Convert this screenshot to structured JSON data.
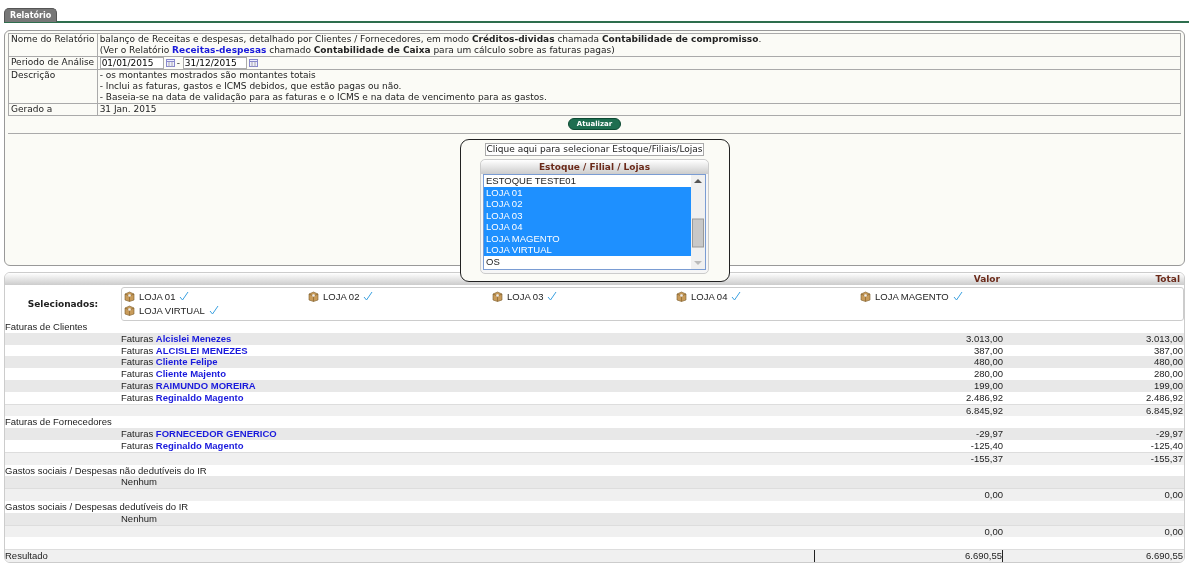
{
  "tabs": [
    {
      "label": "Relatório",
      "selected": true
    }
  ],
  "report_info": {
    "name": {
      "label": "Nome do Relatório",
      "line_1": "balanço de Receitas e despesas, detalhado por Clientes / Fornecedores, em modo **Créditos-dividas** chamada **Contabilidade de compromisso**.",
      "line_2_before": "(Ver o Relatório",
      "line_2_link": "Receitas-despesas",
      "line_2_after": "chamado **Contabilidade de Caixa** para um cálculo sobre as faturas pagas)"
    },
    "period": {
      "label": "Periodo de Análise",
      "from": "01/01/2015",
      "separator": "-",
      "to": "31/12/2015"
    },
    "description": {
      "label": "Descrição",
      "lines": [
        "- os montantes mostrados são montantes totais",
        "- Inclui as faturas, gastos e ICMS debidos, que estão pagas ou não.",
        "- Baseia-se na data de validação para as faturas e o ICMS e na data de vencimento para as gastos."
      ]
    },
    "generated": {
      "label": "Gerado a",
      "value": "31 Jan. 2015"
    }
  },
  "update_button": "Atualizar",
  "store_selector": {
    "toggle_label": "Clique aqui para selecionar Estoque/Filiais/Lojas",
    "title": "Estoque / Filial / Lojas",
    "options": [
      {
        "label": "ESTOQUE TESTE01",
        "selected": false
      },
      {
        "label": "LOJA 01",
        "selected": true
      },
      {
        "label": "LOJA 02",
        "selected": true
      },
      {
        "label": "LOJA 03",
        "selected": true
      },
      {
        "label": "LOJA 04",
        "selected": true
      },
      {
        "label": "LOJA MAGENTO",
        "selected": true
      },
      {
        "label": "LOJA VIRTUAL",
        "selected": true
      },
      {
        "label": "OS",
        "selected": false
      }
    ]
  },
  "results": {
    "columns": [
      "Valor",
      "Total"
    ],
    "selected_label": "Selecionados:",
    "selected_stores": [
      {
        "label": "LOJA 01",
        "checked": true
      },
      {
        "label": "LOJA 02",
        "checked": true
      },
      {
        "label": "LOJA 03",
        "checked": true
      },
      {
        "label": "LOJA 04",
        "checked": true
      },
      {
        "label": "LOJA MAGENTO",
        "checked": true
      },
      {
        "label": "LOJA VIRTUAL",
        "checked": true
      }
    ],
    "sections": [
      {
        "title": "Faturas de Clientes",
        "rows": [
          {
            "prefix": "Faturas",
            "name": "Alcislei Menezes",
            "valor": "3.013,00",
            "total": "3.013,00"
          },
          {
            "prefix": "Faturas",
            "name": "ALCISLEI MENEZES",
            "valor": "387,00",
            "total": "387,00"
          },
          {
            "prefix": "Faturas",
            "name": "Cliente Felipe",
            "valor": "480,00",
            "total": "480,00"
          },
          {
            "prefix": "Faturas",
            "name": "Cliente Majento",
            "valor": "280,00",
            "total": "280,00"
          },
          {
            "prefix": "Faturas",
            "name": "RAIMUNDO MOREIRA",
            "valor": "199,00",
            "total": "199,00"
          },
          {
            "prefix": "Faturas",
            "name": "Reginaldo Magento",
            "valor": "2.486,92",
            "total": "2.486,92"
          }
        ],
        "subtotal": {
          "valor": "6.845,92",
          "total": "6.845,92"
        }
      },
      {
        "title": "Faturas de Fornecedores",
        "rows": [
          {
            "prefix": "Faturas",
            "name": "FORNECEDOR GENERICO",
            "valor": "-29,97",
            "total": "-29,97"
          },
          {
            "prefix": "Faturas",
            "name": "Reginaldo Magento",
            "valor": "-125,40",
            "total": "-125,40"
          }
        ],
        "subtotal": {
          "valor": "-155,37",
          "total": "-155,37"
        }
      },
      {
        "title": "Gastos sociais / Despesas não dedutíveis do IR",
        "empty_label": "Nenhum",
        "subtotal": {
          "valor": "0,00",
          "total": "0,00"
        }
      },
      {
        "title": "Gastos sociais / Despesas dedutíveis do IR",
        "empty_label": "Nenhum",
        "subtotal": {
          "valor": "0,00",
          "total": "0,00"
        }
      }
    ],
    "result": {
      "label": "Resultado",
      "valor": "6.690,55",
      "total": "6.690,55"
    }
  }
}
